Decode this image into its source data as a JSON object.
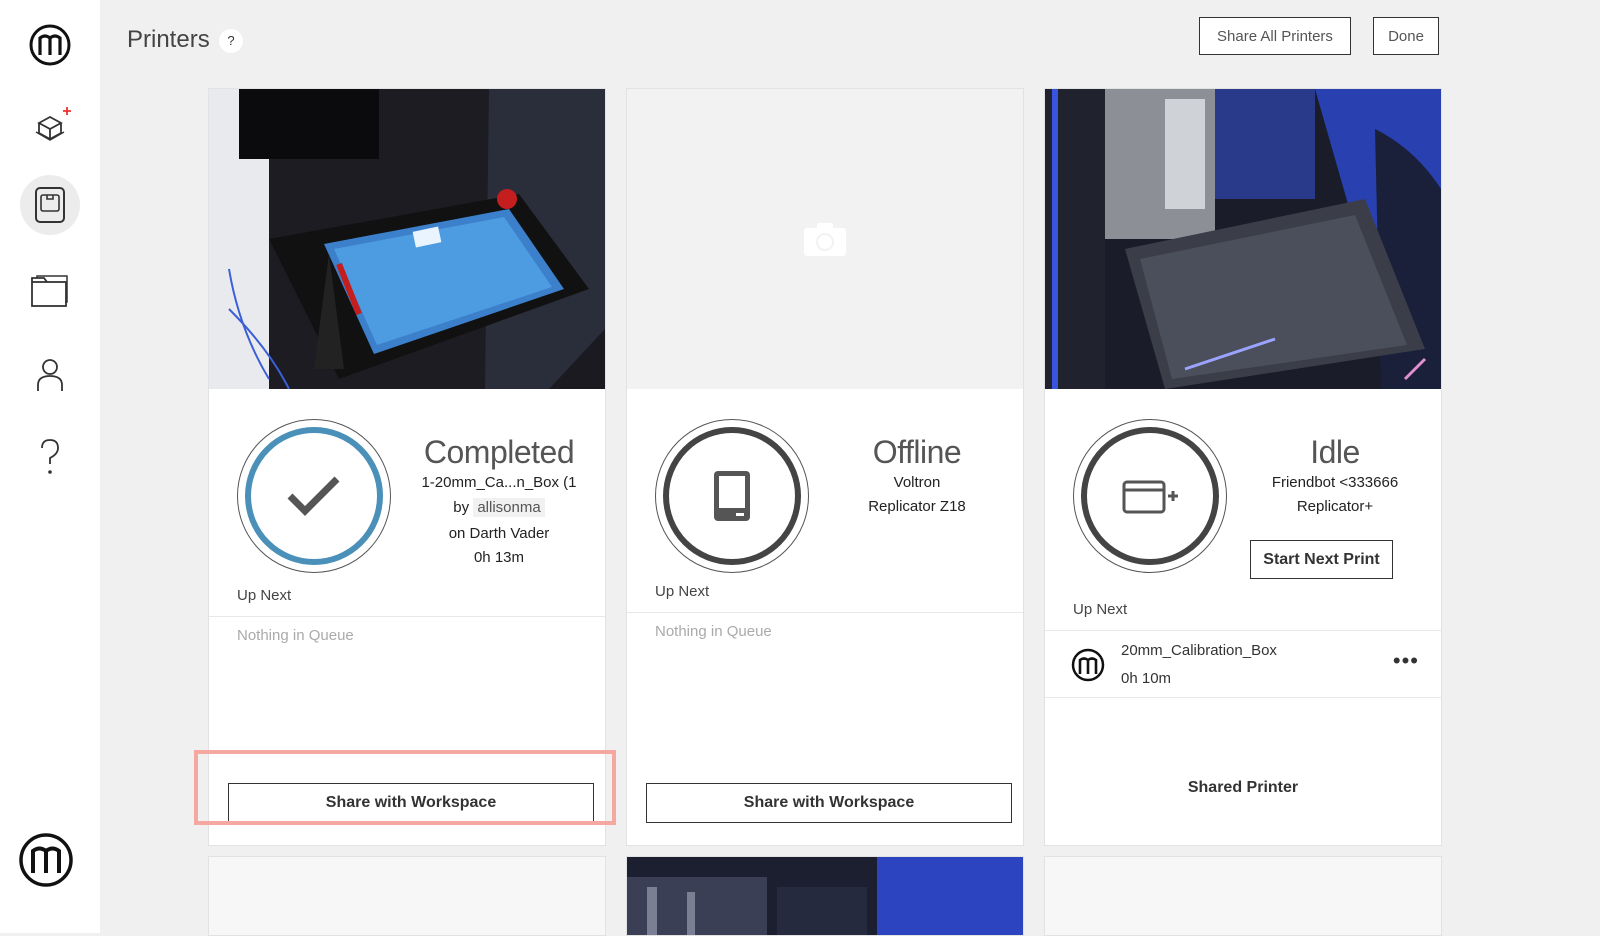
{
  "header": {
    "title": "Printers",
    "help": "?",
    "share_all": "Share All Printers",
    "done": "Done"
  },
  "sidebar": {
    "items": [
      {
        "icon": "makerbot-logo-icon"
      },
      {
        "icon": "prepare-icon"
      },
      {
        "icon": "printers-icon",
        "active": true
      },
      {
        "icon": "library-icon"
      },
      {
        "icon": "account-icon"
      },
      {
        "icon": "help-icon"
      }
    ],
    "bottom_icon": "makerbot-account-icon"
  },
  "cards": [
    {
      "photo": "camera-feed-printer-1",
      "status": "Completed",
      "line1": "1-20mm_Ca...n_Box (1",
      "by": "by",
      "author": "allisonma",
      "on": "on Darth Vader",
      "duration": "0h 13m",
      "up_next": "Up Next",
      "queue_empty": "Nothing in Queue",
      "action": "Share with Workspace"
    },
    {
      "photo": "camera-placeholder",
      "status": "Offline",
      "line1": "Voltron",
      "line2": "Replicator Z18",
      "up_next": "Up Next",
      "queue_empty": "Nothing in Queue",
      "action": "Share with Workspace"
    },
    {
      "photo": "camera-feed-printer-3",
      "status": "Idle",
      "line1": "Friendbot <333666",
      "line2": "Replicator+",
      "start_next": "Start Next Print",
      "up_next": "Up Next",
      "queue_item": {
        "name": "20mm_Calibration_Box",
        "time": "0h 10m",
        "menu": "•••"
      },
      "shared": "Shared Printer"
    }
  ],
  "colors": {
    "accent_blue": "#4a90b8",
    "highlight": "#f4a8a0",
    "background": "#f0f0f0"
  }
}
